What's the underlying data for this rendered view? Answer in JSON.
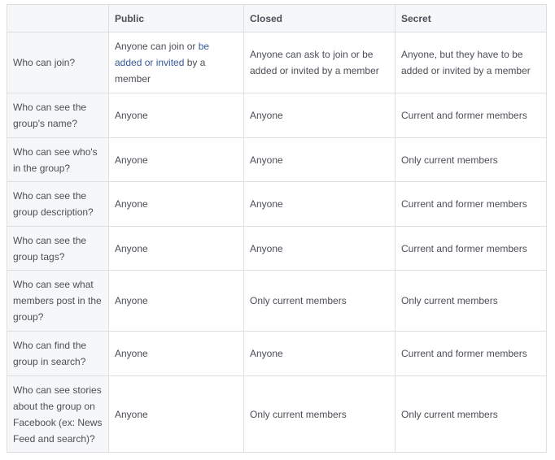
{
  "table": {
    "headers": [
      "",
      "Public",
      "Closed",
      "Secret"
    ],
    "rows": [
      {
        "question": "Who can join?",
        "public_parts": [
          {
            "text": "Anyone can join or ",
            "link": false
          },
          {
            "text": "be added or invited",
            "link": true
          },
          {
            "text": " by a member",
            "link": false
          }
        ],
        "closed": "Anyone can ask to join or be added or invited by a member",
        "secret": "Anyone, but they have to be added or invited by a member"
      },
      {
        "question": "Who can see the group's name?",
        "public": "Anyone",
        "closed": "Anyone",
        "secret": "Current and former members"
      },
      {
        "question": "Who can see who's in the group?",
        "public": "Anyone",
        "closed": "Anyone",
        "secret": "Only current members"
      },
      {
        "question": "Who can see the group description?",
        "public": "Anyone",
        "closed": "Anyone",
        "secret": "Current and former members"
      },
      {
        "question": "Who can see the group tags?",
        "public": "Anyone",
        "closed": "Anyone",
        "secret": "Current and former members"
      },
      {
        "question": "Who can see what members post in the group?",
        "public": "Anyone",
        "closed": "Only current members",
        "secret": "Only current members"
      },
      {
        "question": "Who can find the group in search?",
        "public": "Anyone",
        "closed": "Anyone",
        "secret": "Current and former members"
      },
      {
        "question": "Who can see stories about the group on Facebook (ex: News Feed and search)?",
        "public": "Anyone",
        "closed": "Only current members",
        "secret": "Only current members"
      }
    ]
  },
  "colors": {
    "text": "#4b4f56",
    "link": "#365899",
    "header_bg": "#f6f7f9",
    "grid": "#dddfe2",
    "outer_border": "#1d2129"
  }
}
